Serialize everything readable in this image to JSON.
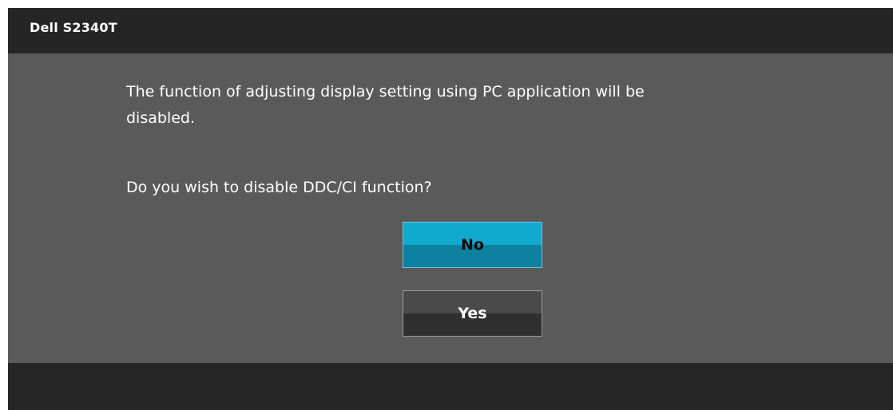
{
  "dialog": {
    "title": "Dell S2340T",
    "message_lines": [
      "The function of adjusting display setting using PC application will be",
      "disabled."
    ],
    "question": "Do you wish to disable DDC/CI function?"
  },
  "buttons": {
    "no_label": "No",
    "yes_label": "Yes"
  },
  "colors": {
    "title_bar": "#252525",
    "content_bg": "#5a5a5a",
    "footer_bg": "#262626",
    "selected_button": "#12a9cf",
    "unselected_button": "#3a3a3a",
    "text": "#ffffff"
  }
}
